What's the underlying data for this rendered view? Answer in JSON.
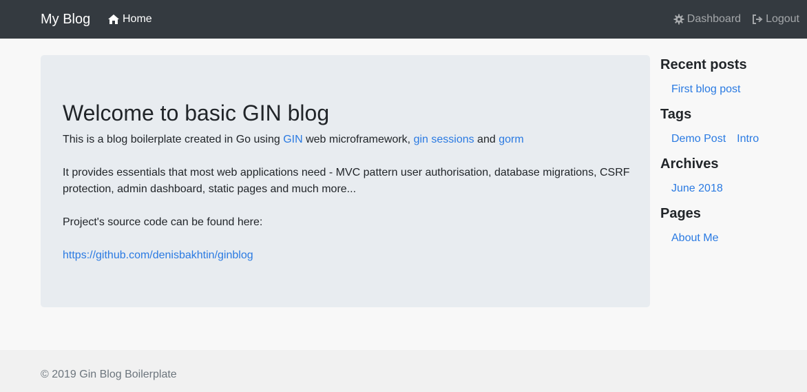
{
  "navbar": {
    "brand": "My Blog",
    "home": {
      "icon": "home-icon",
      "label": "Home"
    },
    "dashboard": {
      "icon": "gear-icon",
      "label": "Dashboard"
    },
    "logout": {
      "icon": "sign-out-icon",
      "label": "Logout"
    }
  },
  "jumbotron": {
    "title": "Welcome to basic GIN blog",
    "intro_prefix": "This is a blog boilerplate created in Go using ",
    "link_gin": "GIN",
    "intro_mid1": " web microframework, ",
    "link_sessions": "gin sessions",
    "intro_mid2": " and ",
    "link_gorm": "gorm",
    "paragraph2": "It provides essentials that most web applications need - MVC pattern user authorisation, database migrations, CSRF protection, admin dashboard, static pages and much more...",
    "paragraph3": "Project's source code can be found here:",
    "repo_link": "https://github.com/denisbakhtin/ginblog"
  },
  "sidebar": {
    "recent_heading": "Recent posts",
    "recent_items": [
      "First blog post"
    ],
    "tags_heading": "Tags",
    "tags_items": [
      "Demo Post",
      "Intro"
    ],
    "archives_heading": "Archives",
    "archives_items": [
      "June 2018"
    ],
    "pages_heading": "Pages",
    "pages_items": [
      "About Me"
    ]
  },
  "footer": {
    "text": "© 2019 Gin Blog Boilerplate"
  },
  "colors": {
    "navbar_bg": "#343a40",
    "link": "#2a7ae2",
    "jumbotron_bg": "#e8ecf0"
  }
}
